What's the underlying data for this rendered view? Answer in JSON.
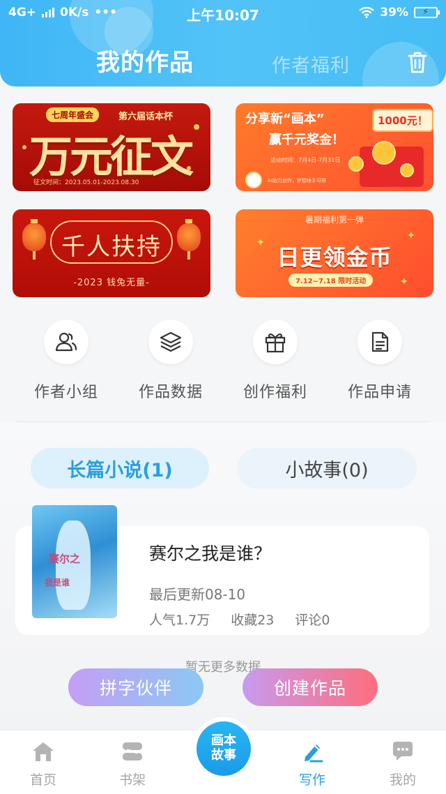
{
  "status_bar": {
    "network": "4G+",
    "speed": "0K/s",
    "dots": "•••",
    "time": "上午10:07",
    "battery": "39%",
    "battery_level": 0.39
  },
  "header": {
    "tab_active": "我的作品",
    "tab_inactive": "作者福利",
    "trash_icon": "trash-icon"
  },
  "banners": {
    "b1": {
      "pill": "七周年盛会",
      "cup": "第六届话本杯",
      "title": "万元征文",
      "date": "征文时间：2023.05.01-2023.08.30"
    },
    "b2": {
      "line1": "分享新“画本”",
      "line2": "赢千元奖金！",
      "badge": "1000元！",
      "date": "活动时间：7月4日-7月31日",
      "note": "AI助力创作，梦想唾手可得"
    },
    "b3": {
      "title": "千人扶持",
      "subtitle": "-2023 钱兔无量-"
    },
    "b4": {
      "top": "暑期福利第一弹",
      "title": "日更领金币",
      "date": "7.12~7.18 限时活动"
    }
  },
  "quick_actions": [
    {
      "label": "作者小组",
      "icon": "users-icon"
    },
    {
      "label": "作品数据",
      "icon": "layers-icon"
    },
    {
      "label": "创作福利",
      "icon": "gift-icon"
    },
    {
      "label": "作品申请",
      "icon": "document-icon"
    }
  ],
  "category_tabs": {
    "active": "长篇小说(1)",
    "inactive": "小故事(0)"
  },
  "works": [
    {
      "title": "赛尔之我是谁？",
      "updated": "最后更新08-10",
      "popularity": "人气1.7万",
      "favorites": "收藏23",
      "comments": "评论0",
      "cover_text_1": "赛尔之",
      "cover_text_2": "我是谁"
    }
  ],
  "no_more": "暂无更多数据",
  "fab": {
    "left": "拼字伙伴",
    "right": "创建作品"
  },
  "bottom_nav": {
    "home": "首页",
    "shelf": "书架",
    "center_line1": "画本",
    "center_line2": "故事",
    "write": "写作",
    "mine": "我的"
  },
  "colors": {
    "accent": "#2a9fe0",
    "header": "#46bdf6",
    "fab_left": "#a8b6f5",
    "fab_right": "#f07a90"
  }
}
